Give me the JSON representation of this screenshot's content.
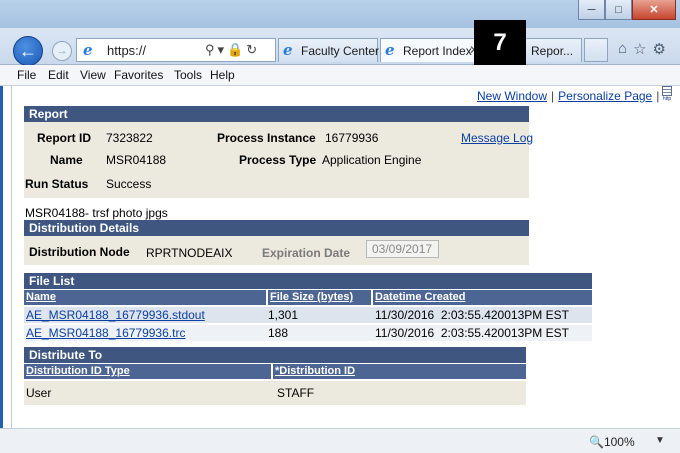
{
  "browser": {
    "address": "https://",
    "tabs": [
      {
        "label": "Faculty Center"
      },
      {
        "label": "Report Index"
      },
      {
        "label": "Repor..."
      }
    ],
    "step_badge": "7",
    "menu": [
      "File",
      "Edit",
      "View",
      "Favorites",
      "Tools",
      "Help"
    ],
    "zoom": "100%"
  },
  "toplinks": {
    "new_window": "New Window",
    "separator": "|",
    "personalize": "Personalize Page",
    "icon_caption": "http"
  },
  "report": {
    "header": "Report",
    "report_id_label": "Report ID",
    "report_id": "7323822",
    "process_instance_label": "Process Instance",
    "process_instance": "16779936",
    "message_log": "Message Log",
    "name_label": "Name",
    "name": "MSR04188",
    "process_type_label": "Process Type",
    "process_type": "Application Engine",
    "run_status_label": "Run Status",
    "run_status": "Success",
    "description": "MSR04188- trsf photo jpgs"
  },
  "distribution_details": {
    "header": "Distribution Details",
    "node_label": "Distribution Node",
    "node": "RPRTNODEAIX",
    "expiration_label": "Expiration Date",
    "expiration": "03/09/2017"
  },
  "file_list": {
    "header": "File List",
    "columns": [
      "Name",
      "File Size (bytes)",
      "Datetime Created"
    ],
    "rows": [
      {
        "name": "AE_MSR04188_16779936.stdout",
        "size": "1,301",
        "created": "11/30/2016  2:03:55.420013PM EST"
      },
      {
        "name": "AE_MSR04188_16779936.trc",
        "size": "188",
        "created": "11/30/2016  2:03:55.420013PM EST"
      }
    ]
  },
  "distribute_to": {
    "header": "Distribute To",
    "columns": [
      "Distribution ID Type",
      "*Distribution ID"
    ],
    "rows": [
      {
        "type": "User",
        "id": "STAFF"
      }
    ]
  }
}
